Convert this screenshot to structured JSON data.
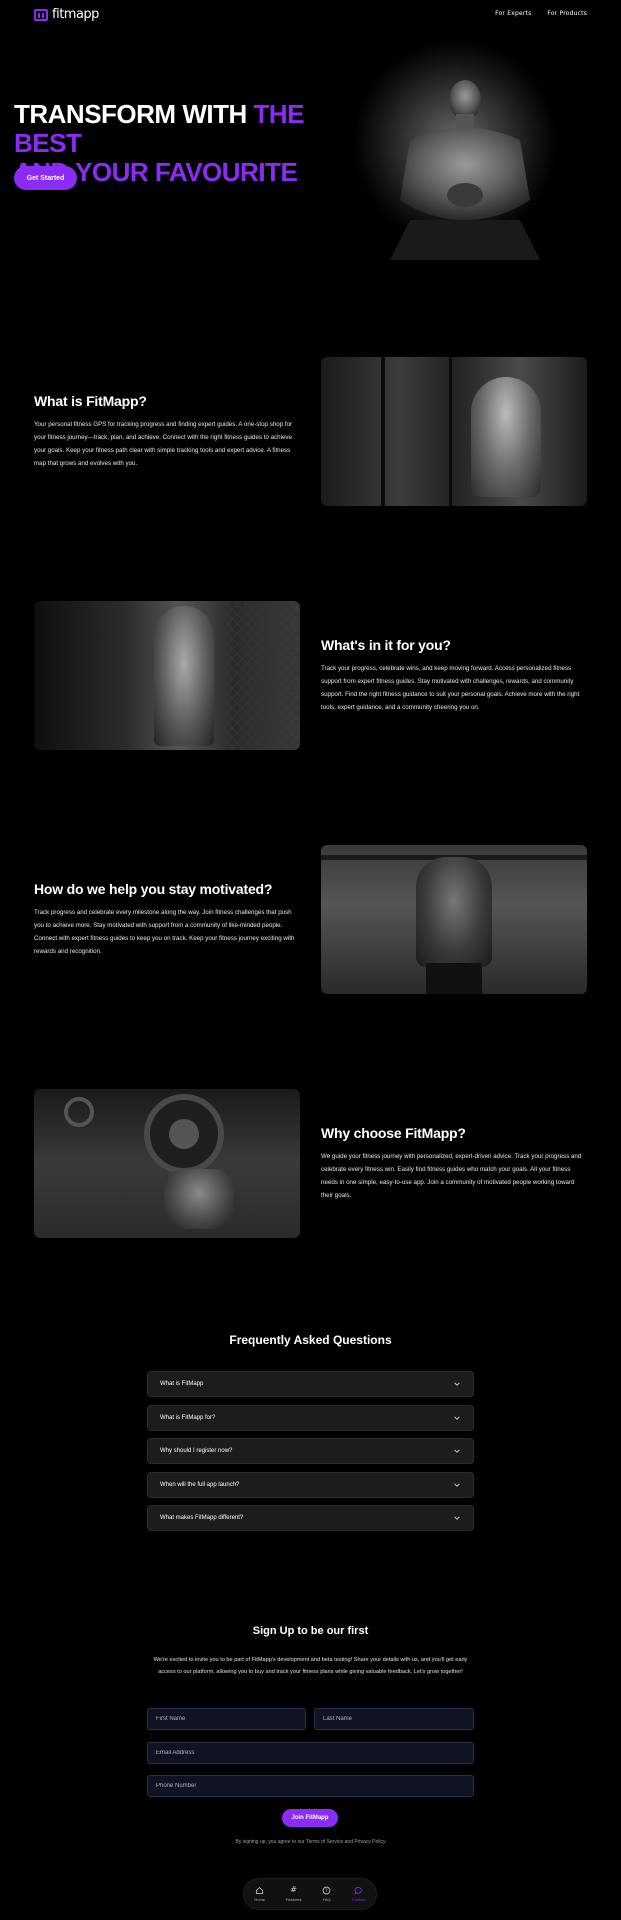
{
  "brand": {
    "name": "fitmapp",
    "accent": "#8b2cf5"
  },
  "nav": {
    "experts": "For Experts",
    "products": "For Products"
  },
  "hero": {
    "title_white": "Transform with ",
    "title_purple_1": "the best",
    "title_purple_2": "and your favourite",
    "cta": "Get Started"
  },
  "sections": [
    {
      "title": "What is FitMapp?",
      "text": "Your personal fitness GPS for tracking progress and finding expert guides. A one-stop shop for your fitness journey—track, plan, and achieve. Connect with the right fitness guides to achieve your goals. Keep your fitness path clear with simple tracking tools and expert advice. A fitness map that grows and evolves with you."
    },
    {
      "title": "What's in it for you?",
      "text": "Track your progress, celebrate wins, and keep moving forward. Access personalized fitness support from expert fitness guides. Stay motivated with challenges, rewards, and community support. Find the right fitness guidance to suit your personal goals. Achieve more with the right tools, expert guidance, and a community cheering you on."
    },
    {
      "title": "How do we help you stay motivated?",
      "text": "Track progress and celebrate every milestone along the way. Join fitness challenges that push you to achieve more. Stay motivated with support from a community of like-minded people. Connect with expert fitness guides to keep you on track. Keep your fitness journey exciting with rewards and recognition."
    },
    {
      "title": "Why choose FitMapp?",
      "text": "We guide your fitness journey with personalized, expert-driven advice. Track your progress and celebrate every fitness win. Easily find fitness guides who match your goals. All your fitness needs in one simple, easy-to-use app. Join a community of motivated people working toward their goals."
    }
  ],
  "faq": {
    "title": "Frequently Asked Questions",
    "items": [
      "What is FitMapp",
      "What is FitMapp for?",
      "Why should I register now?",
      "When will the full app launch?",
      "What makes FitMapp different?"
    ]
  },
  "signup": {
    "title": "Sign Up to be our first",
    "text": "We're excited to invite you to be part of FitMapp's development and beta testing! Share your details with us, and you'll get early access to our platform, allowing you to buy and track your fitness plans while giving valuable feedback. Let's grow together!",
    "first_name": "First Name",
    "last_name": "Last Name",
    "email": "Email Address",
    "phone": "Phone Number",
    "cta": "Join FitMapp",
    "terms": "By signing up, you agree to our Terms of Service and Privacy Policy"
  },
  "bottom_nav": [
    {
      "label": "Home",
      "icon": "home-icon"
    },
    {
      "label": "Features",
      "icon": "hash-icon"
    },
    {
      "label": "FAQ",
      "icon": "help-icon"
    },
    {
      "label": "Contact",
      "icon": "chat-icon",
      "active": true
    }
  ]
}
